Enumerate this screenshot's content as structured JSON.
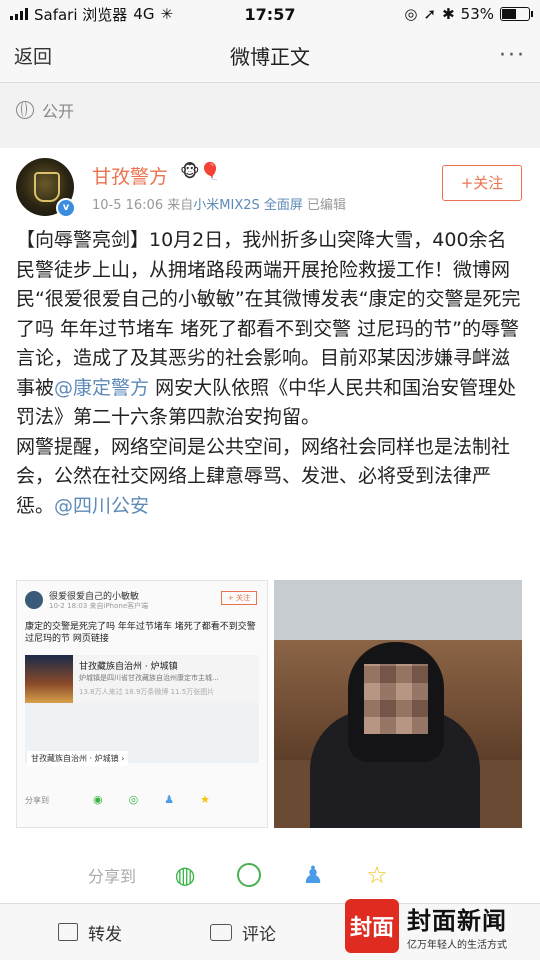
{
  "status_bar": {
    "carrier": "Safari 浏览器",
    "network": "4G",
    "time": "17:57",
    "battery": "53%",
    "battery_level": 0.53
  },
  "nav": {
    "back": "返回",
    "title": "微博正文",
    "more": "···"
  },
  "visibility": "公开",
  "post": {
    "author": "甘孜警方",
    "author_icons": "🐵🎈",
    "date": "10-5 16:06",
    "source_prefix": "来自",
    "source": "小米MIX2S 全面屏",
    "edited": "已编辑",
    "follow": "+关注",
    "text": {
      "p1": "【向辱警亮剑】10月2日，我州折多山突降大雪，400余名民警徒步上山，从拥堵路段两端开展抢险救援工作！微博网民“很爱很爱自己的小敏敏”在其微博发表“康定的交警是死完了吗 年年过节堵车 堵死了都看不到交警 过尼玛的节”的辱警言论，造成了及其恶劣的社会影响。目前邓某因涉嫌寻衅滋事被",
      "mention1": "@康定警方",
      "p2": "网安大队依照《中华人民共和国治安管理处罚法》第二十六条第四款治安拘留。",
      "p3": "网警提醒，网络空间是公共空间，网络社会同样也是法制社会，公然在社交网络上肆意辱骂、发泄、必将受到法律严惩。",
      "mention2": "@四川公安"
    },
    "image1": {
      "user": "很爱很爱自己的小敏敏",
      "meta": "10-2 18:03 来自iPhone客户端",
      "follow": "+ 关注",
      "text": "康定的交警是死完了吗 年年过节堵车 堵死了都看不到交警 过尼玛的节 网页链接",
      "box_title": "甘孜藏族自治州 · 炉城镇",
      "box_desc": "炉城镇是四川省甘孜藏族自治州康定市主城...",
      "box_stats": "13.8万人来过 18.9万条微博 11.5万张图片",
      "map_label": "甘孜藏族自治州 · 炉城镇 ›",
      "share": "分享到"
    }
  },
  "share_bar": {
    "label": "分享到",
    "icons": [
      "wechat-icon",
      "moments-icon",
      "qq-icon",
      "qzone-icon"
    ]
  },
  "bottom_bar": {
    "repost": "转发",
    "comment": "评论"
  },
  "watermark": {
    "logo": "封面",
    "name": "封面新闻",
    "slogan": "亿万年轻人的生活方式"
  }
}
